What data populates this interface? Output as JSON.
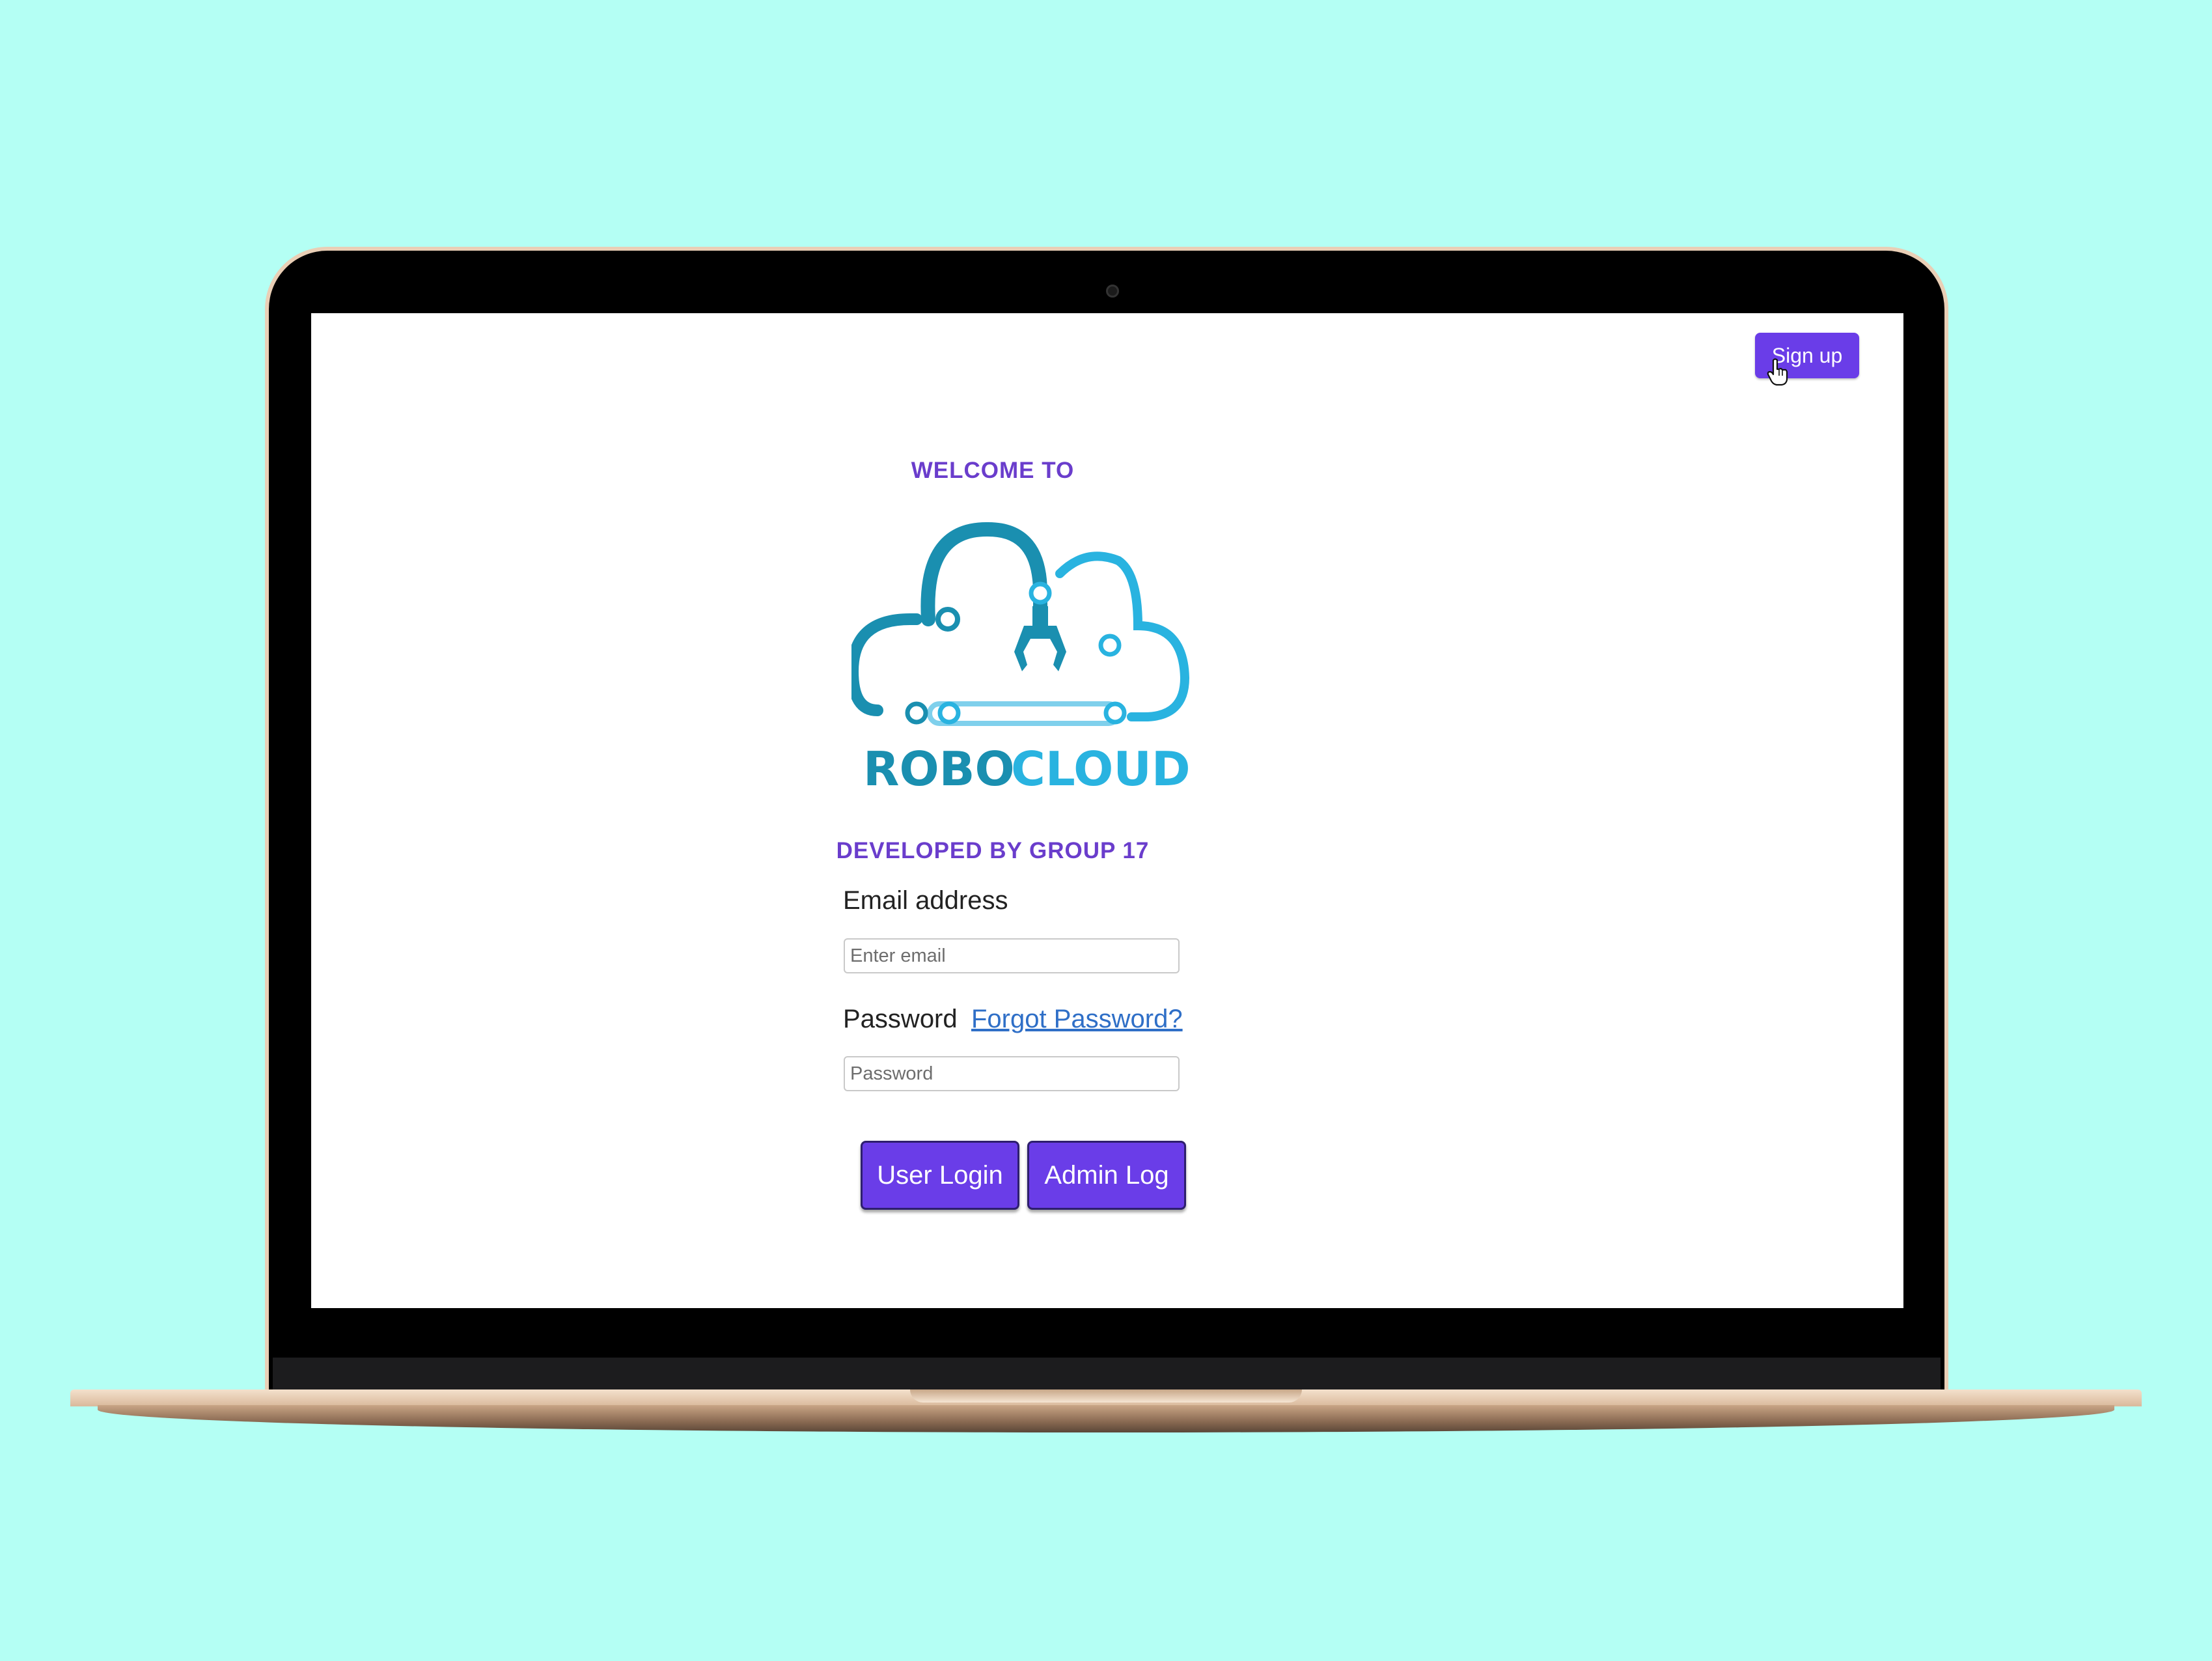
{
  "header": {
    "signup_label": "Sign up"
  },
  "hero": {
    "welcome": "WELCOME TO",
    "logo_text_left": "ROBO",
    "logo_text_right": "CLOUD",
    "developed_by": "DEVELOPED BY GROUP 17"
  },
  "form": {
    "email_label": "Email address",
    "email_placeholder": "Enter email",
    "email_value": "",
    "password_label": "Password",
    "forgot_password": "Forgot Password?",
    "password_placeholder": "Password",
    "password_value": "",
    "user_login_label": "User Login",
    "admin_login_label": "Admin Log"
  },
  "colors": {
    "background": "#b4fff4",
    "accent": "#6a3de8",
    "heading": "#6a3dcc",
    "logo_dark": "#1a8fb0",
    "logo_light": "#29b3e0",
    "link": "#2f6fc7"
  },
  "icons": {
    "cursor": "hand-pointer-icon",
    "logo": "robocloud-logo-icon"
  }
}
